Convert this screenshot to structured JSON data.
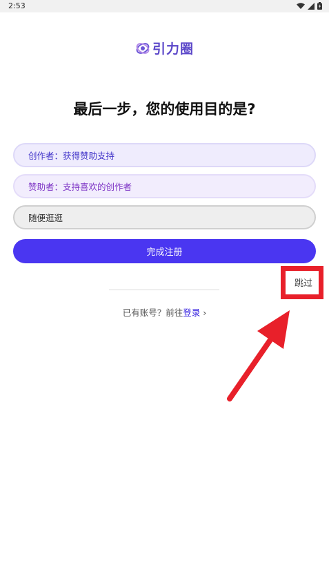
{
  "status_bar": {
    "time": "2:53"
  },
  "logo": {
    "text": "引力圈"
  },
  "page": {
    "title": "最后一步，您的使用目的是?"
  },
  "options": [
    {
      "label": "创作者：获得赞助支持"
    },
    {
      "label": "赞助者：支持喜欢的创作者"
    },
    {
      "label": "随便逛逛"
    }
  ],
  "actions": {
    "submit_label": "完成注册",
    "skip_label": "跳过"
  },
  "login": {
    "prompt": "已有账号？前往",
    "link_label": "登录",
    "chevron": "›"
  },
  "colors": {
    "accent": "#4a36f1",
    "highlight": "#e8202a",
    "logo": "#5b47c9"
  }
}
